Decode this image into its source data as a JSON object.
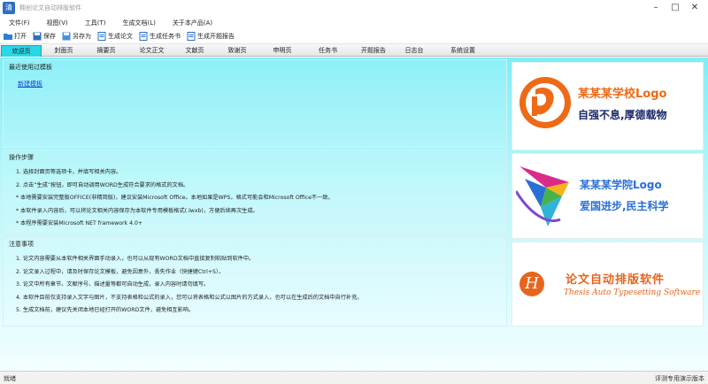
{
  "window": {
    "title": "翱创论文自动排版软件",
    "icon_char": "清"
  },
  "menu": [
    "文件(F)",
    "视图(V)",
    "工具(T)",
    "生成文档(L)",
    "关于本产品(A)"
  ],
  "toolbar": [
    {
      "label": "打开",
      "icon": "folder-open-icon"
    },
    {
      "label": "保存",
      "icon": "save-icon"
    },
    {
      "label": "另存为",
      "icon": "save-as-icon"
    },
    {
      "label": "生成论文",
      "icon": "document-icon"
    },
    {
      "label": "生成任务书",
      "icon": "document-icon"
    },
    {
      "label": "生成开题报告",
      "icon": "document-icon"
    }
  ],
  "tabs": [
    "欢迎页",
    "封面页",
    "摘要页",
    "论文正文",
    "文献页",
    "致谢页",
    "申明页",
    "任务书",
    "开题报告",
    "日志台",
    "系统设置"
  ],
  "panels": {
    "recent": {
      "title": "最近使用过模板",
      "link": "新建模板"
    },
    "steps": {
      "title": "操作步骤",
      "items": [
        "1. 选择封面页等选项卡，并填写相关内容。",
        "2. 点击“生成”按钮，即可自动调用WORD生成符合要求的格式的文档。",
        "* 本地需要安装完整版OFFICE(非精简版)，建议安装Microsoft Office。本地如果是WPS，格式可能会和Microsoft Office不一致。",
        "* 本软件录入内容后，可以将论文相关内容保存为本软件专用模板格式(.lwxb)，方便后续再次生成。",
        "* 本程序需要安装Microsoft NET framework 4.0+"
      ]
    },
    "notes": {
      "title": "注意事项",
      "items": [
        "1. 论文内容需要从本软件相关界面手动录入，也可以从现有WORD文档中直接复制粘贴到软件中。",
        "2. 论文录入过程中，请及时保存论文模板，避免因意外，丢失作业（快捷键Ctrl+S）。",
        "3. 论文中所有章节、文献序号、描述量等都可自动生成，录入内容时请勿填写。",
        "4. 本软件目前仅支持录入文字与图片，不支持表格和公式的录入，您可以将表格和公式以图片的方式录入，也可以在生成后的文档中自行补充。",
        "5. 生成文档前，建议先关闭本地已经打开的WORD文件，避免相互影响。"
      ]
    }
  },
  "side": {
    "logo1": {
      "line1": "某某某学校Logo",
      "line2": "自强不息,厚德载物",
      "accent": "#ee6a16"
    },
    "logo2": {
      "line1": "某某某学院Logo",
      "line2": "爱国进步,民主科学",
      "accent": "#2a6fd6"
    },
    "logo3": {
      "line1": "论文自动排版软件",
      "line2": "Thesis Auto Typesetting Software",
      "badge": "H",
      "accent": "#e8641c"
    }
  },
  "status": {
    "left": "就绪",
    "right": "评测专用演示版本"
  }
}
